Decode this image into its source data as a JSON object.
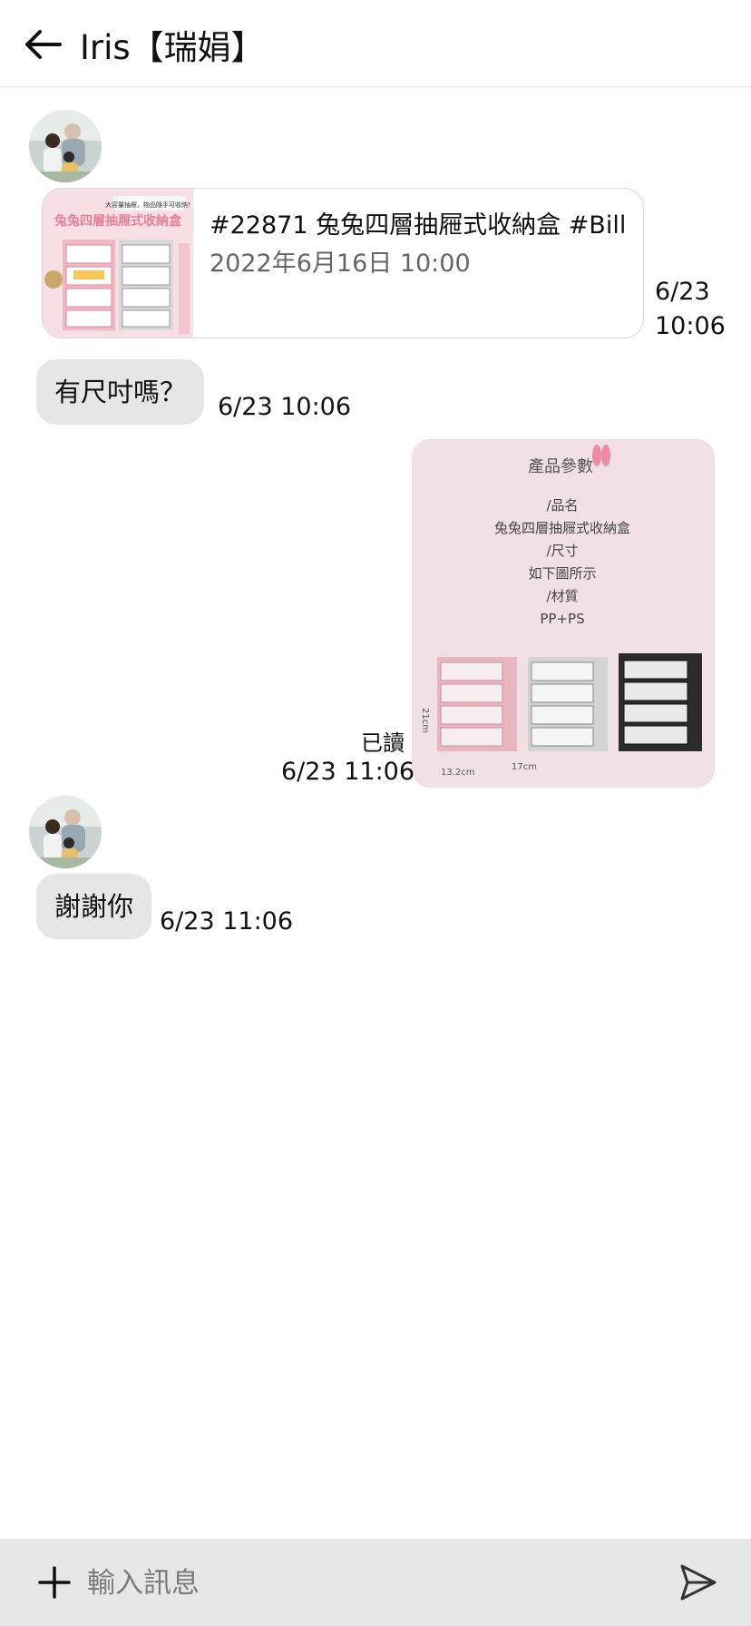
{
  "header": {
    "title": "Iris【瑞娟】",
    "back_icon": "arrow-left-icon"
  },
  "messages": {
    "product_card": {
      "title": "#22871 兔兔四層抽屜式收納盒 #Bill",
      "date": "2022年6月16日 10:00",
      "thumb_text_top": "大容量抽屜，物品隨手可收納！",
      "thumb_text_main": "兔兔四層抽屜式收納盒",
      "timestamp_line1": "6/23",
      "timestamp_line2": "10:06"
    },
    "msg1": {
      "text": "有尺吋嗎？",
      "timestamp": "6/23 10:06"
    },
    "image_msg": {
      "title": "產品參數",
      "lines": [
        "/品名",
        "兔兔四層抽屜式收納盒",
        "/尺寸",
        "如下圖所示",
        "/材質",
        "PP+PS"
      ],
      "dim_height": "21cm",
      "dim_width": "13.2cm",
      "dim_depth": "17cm",
      "read_label": "已讀",
      "timestamp": "6/23 11:06"
    },
    "msg2": {
      "text": "謝謝你",
      "timestamp": "6/23 11:06"
    }
  },
  "inputbar": {
    "placeholder": "輸入訊息",
    "plus_icon": "plus-icon",
    "send_icon": "send-icon"
  },
  "colors": {
    "bubble": "#e6e6e6",
    "header_bg": "#ffffff",
    "inputbar_bg": "#e5e7ea",
    "image_bg": "#f3e3e6",
    "pink_drawer": "#e8b6c0"
  }
}
